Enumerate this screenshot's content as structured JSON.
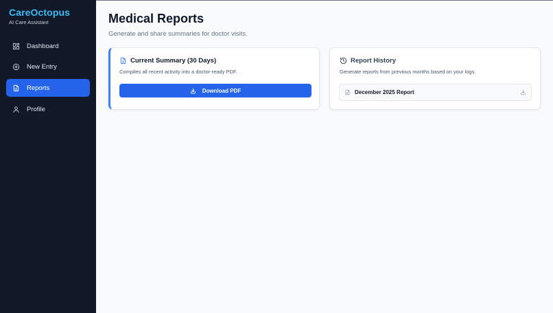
{
  "app": {
    "name": "CareOctopus",
    "tagline": "AI Care Assistant"
  },
  "sidebar": {
    "items": [
      {
        "label": "Dashboard",
        "icon": "dashboard-icon",
        "active": false
      },
      {
        "label": "New Entry",
        "icon": "plus-circle-icon",
        "active": false
      },
      {
        "label": "Reports",
        "icon": "document-icon",
        "active": true
      },
      {
        "label": "Profile",
        "icon": "user-icon",
        "active": false
      }
    ]
  },
  "page": {
    "title": "Medical Reports",
    "subtitle": "Generate and share summaries for doctor visits."
  },
  "summary_card": {
    "title": "Current Summary (30 Days)",
    "description": "Compiles all recent activity into a doctor-ready PDF.",
    "button_label": "Download PDF",
    "icon": "document-icon"
  },
  "history_card": {
    "title": "Report History",
    "description": "Generate reports from previous months based on your logs.",
    "icon": "history-icon",
    "reports": [
      {
        "name": "December 2025 Report"
      }
    ]
  },
  "colors": {
    "sidebar_bg": "#111827",
    "brand": "#38bdf8",
    "accent": "#2563eb",
    "page_bg": "#f8fafc"
  }
}
